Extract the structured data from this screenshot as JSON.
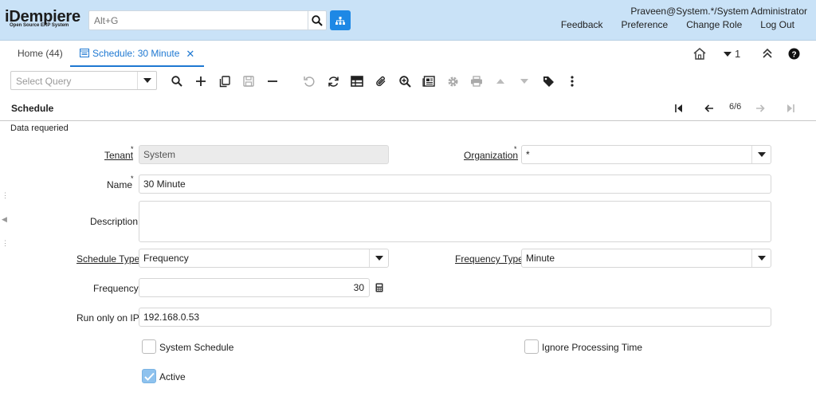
{
  "header": {
    "logo_text": "iDempiere",
    "logo_sub": "Open Source   ERP System",
    "search_placeholder": "Alt+G",
    "user": "Praveen@System.*/System Administrator",
    "links": [
      "Feedback",
      "Preference",
      "Change Role",
      "Log Out"
    ]
  },
  "tabs": {
    "home_label": "Home (44)",
    "active_label": "Schedule: 30 Minute",
    "window_count": "1"
  },
  "toolbar": {
    "query_placeholder": "Select Query"
  },
  "titlebar": {
    "title": "Schedule",
    "record_count": "6/6"
  },
  "status_message": "Data requeried",
  "form": {
    "tenant_label": "Tenant",
    "tenant_value": "System",
    "organization_label": "Organization",
    "organization_value": "*",
    "name_label": "Name",
    "name_value": "30 Minute",
    "description_label": "Description",
    "description_value": "",
    "schedule_type_label": "Schedule Type",
    "schedule_type_value": "Frequency",
    "frequency_type_label": "Frequency Type",
    "frequency_type_value": "Minute",
    "frequency_label": "Frequency",
    "frequency_value": "30",
    "run_only_ip_label": "Run only on IP",
    "run_only_ip_value": "192.168.0.53",
    "system_schedule_label": "System Schedule",
    "system_schedule_checked": false,
    "ignore_processing_label": "Ignore Processing Time",
    "ignore_processing_checked": false,
    "active_label": "Active",
    "active_checked": true
  },
  "colors": {
    "header_bg": "#c9e2f7",
    "accent": "#1e88e5",
    "active_tab": "#1e78d2"
  }
}
